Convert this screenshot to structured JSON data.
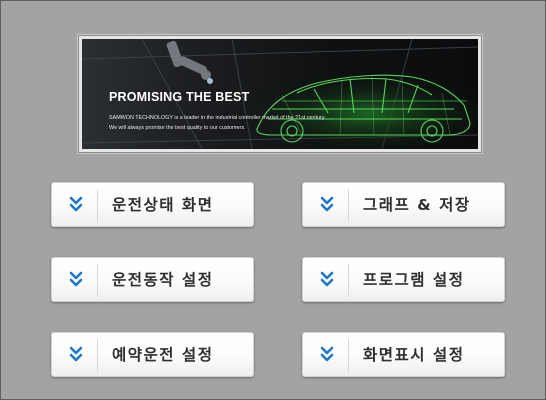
{
  "banner": {
    "headline": "PROMISING THE BEST",
    "line1": "SAMWON TECHNOLOGY is a leader in the industrial controller market of the 21st century.",
    "line2": "We will always promise the best quality to our customers."
  },
  "menu": {
    "items": [
      {
        "label": "운전상태 화면",
        "icon": "double-chevron-down-icon"
      },
      {
        "label": "그래프 & 저장",
        "icon": "double-chevron-down-icon"
      },
      {
        "label": "운전동작 설정",
        "icon": "double-chevron-down-icon"
      },
      {
        "label": "프로그램 설정",
        "icon": "double-chevron-down-icon"
      },
      {
        "label": "예약운전 설정",
        "icon": "double-chevron-down-icon"
      },
      {
        "label": "화면표시 설정",
        "icon": "double-chevron-down-icon"
      }
    ]
  },
  "colors": {
    "background": "#a3a3a1",
    "accent_icon": "#1e78c8",
    "banner_glow": "#3fd04a"
  }
}
